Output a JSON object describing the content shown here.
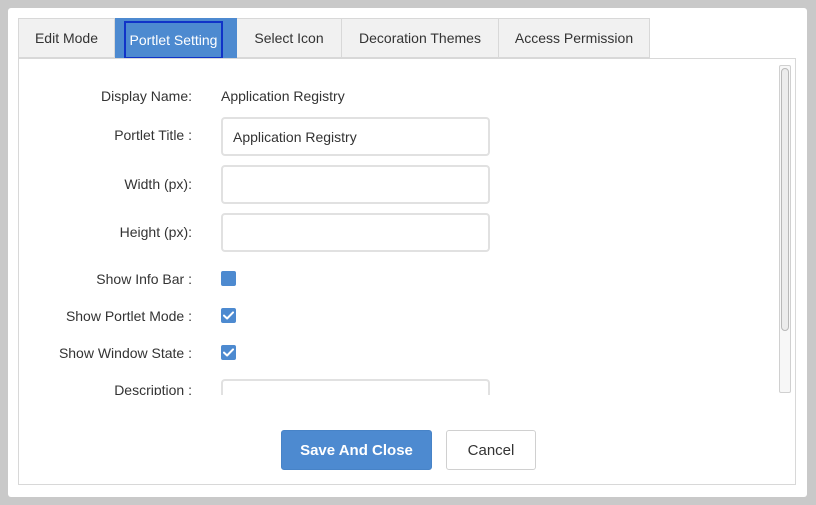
{
  "tabs": [
    {
      "label": "Edit Mode",
      "active": false
    },
    {
      "label": "Portlet Setting",
      "active": true
    },
    {
      "label": "Select Icon",
      "active": false
    },
    {
      "label": "Decoration Themes",
      "active": false
    },
    {
      "label": "Access Permission",
      "active": false
    }
  ],
  "form": {
    "display_name_label": "Display Name:",
    "display_name_value": "Application Registry",
    "portlet_title_label": "Portlet Title :",
    "portlet_title_value": "Application Registry",
    "width_label": "Width (px):",
    "width_value": "",
    "height_label": "Height (px):",
    "height_value": "",
    "show_info_bar_label": "Show Info Bar :",
    "show_info_bar_checked": false,
    "show_portlet_mode_label": "Show Portlet Mode :",
    "show_portlet_mode_checked": true,
    "show_window_state_label": "Show Window State :",
    "show_window_state_checked": true,
    "description_label": "Description :",
    "description_value": ""
  },
  "buttons": {
    "save_label": "Save And Close",
    "cancel_label": "Cancel"
  },
  "colors": {
    "accent": "#4d8ad0",
    "focus_outline": "#1033c8",
    "backdrop": "#c9c9c9"
  }
}
